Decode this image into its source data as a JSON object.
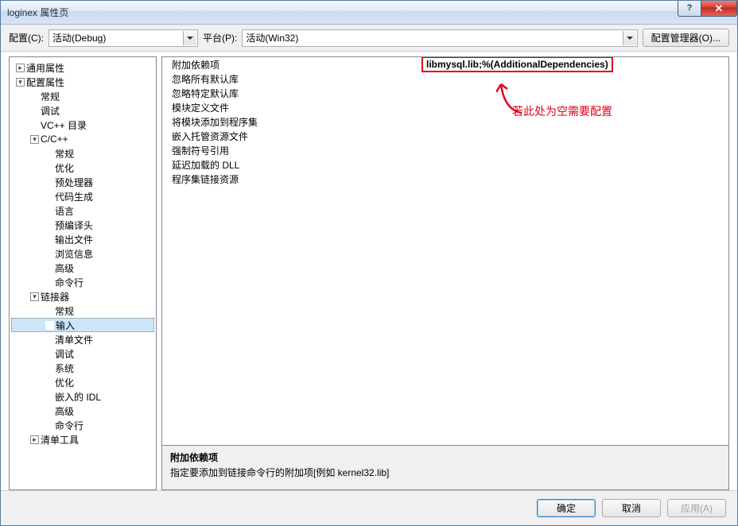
{
  "window": {
    "title": "loginex 属性页"
  },
  "toolbar": {
    "config_label": "配置(C):",
    "config_value": "活动(Debug)",
    "platform_label": "平台(P):",
    "platform_value": "活动(Win32)",
    "manager_btn": "配置管理器(O)..."
  },
  "tree": [
    {
      "indent": 0,
      "toggle": "▸",
      "label": "通用属性"
    },
    {
      "indent": 0,
      "toggle": "▾",
      "label": "配置属性"
    },
    {
      "indent": 1,
      "toggle": "",
      "label": "常规"
    },
    {
      "indent": 1,
      "toggle": "",
      "label": "调试"
    },
    {
      "indent": 1,
      "toggle": "",
      "label": "VC++ 目录"
    },
    {
      "indent": 1,
      "toggle": "▾",
      "label": "C/C++"
    },
    {
      "indent": 2,
      "toggle": "",
      "label": "常规"
    },
    {
      "indent": 2,
      "toggle": "",
      "label": "优化"
    },
    {
      "indent": 2,
      "toggle": "",
      "label": "预处理器"
    },
    {
      "indent": 2,
      "toggle": "",
      "label": "代码生成"
    },
    {
      "indent": 2,
      "toggle": "",
      "label": "语言"
    },
    {
      "indent": 2,
      "toggle": "",
      "label": "预编译头"
    },
    {
      "indent": 2,
      "toggle": "",
      "label": "输出文件"
    },
    {
      "indent": 2,
      "toggle": "",
      "label": "浏览信息"
    },
    {
      "indent": 2,
      "toggle": "",
      "label": "高级"
    },
    {
      "indent": 2,
      "toggle": "",
      "label": "命令行"
    },
    {
      "indent": 1,
      "toggle": "▾",
      "label": "链接器"
    },
    {
      "indent": 2,
      "toggle": "",
      "label": "常规"
    },
    {
      "indent": 2,
      "toggle": "",
      "label": "输入",
      "selected": true
    },
    {
      "indent": 2,
      "toggle": "",
      "label": "清单文件"
    },
    {
      "indent": 2,
      "toggle": "",
      "label": "调试"
    },
    {
      "indent": 2,
      "toggle": "",
      "label": "系统"
    },
    {
      "indent": 2,
      "toggle": "",
      "label": "优化"
    },
    {
      "indent": 2,
      "toggle": "",
      "label": "嵌入的 IDL"
    },
    {
      "indent": 2,
      "toggle": "",
      "label": "高级"
    },
    {
      "indent": 2,
      "toggle": "",
      "label": "命令行"
    },
    {
      "indent": 1,
      "toggle": "▸",
      "label": "清单工具"
    }
  ],
  "grid": [
    {
      "k": "附加依赖项",
      "v": "libmysql.lib;%(AdditionalDependencies)",
      "highlight": true
    },
    {
      "k": "忽略所有默认库",
      "v": ""
    },
    {
      "k": "忽略特定默认库",
      "v": ""
    },
    {
      "k": "模块定义文件",
      "v": ""
    },
    {
      "k": "将模块添加到程序集",
      "v": ""
    },
    {
      "k": "嵌入托管资源文件",
      "v": ""
    },
    {
      "k": "强制符号引用",
      "v": ""
    },
    {
      "k": "延迟加载的 DLL",
      "v": ""
    },
    {
      "k": "程序集链接资源",
      "v": ""
    }
  ],
  "annotation": "若此处为空需要配置",
  "description": {
    "title": "附加依赖项",
    "body": "指定要添加到链接命令行的附加项[例如 kernel32.lib]"
  },
  "buttons": {
    "ok": "确定",
    "cancel": "取消",
    "apply": "应用(A)"
  }
}
